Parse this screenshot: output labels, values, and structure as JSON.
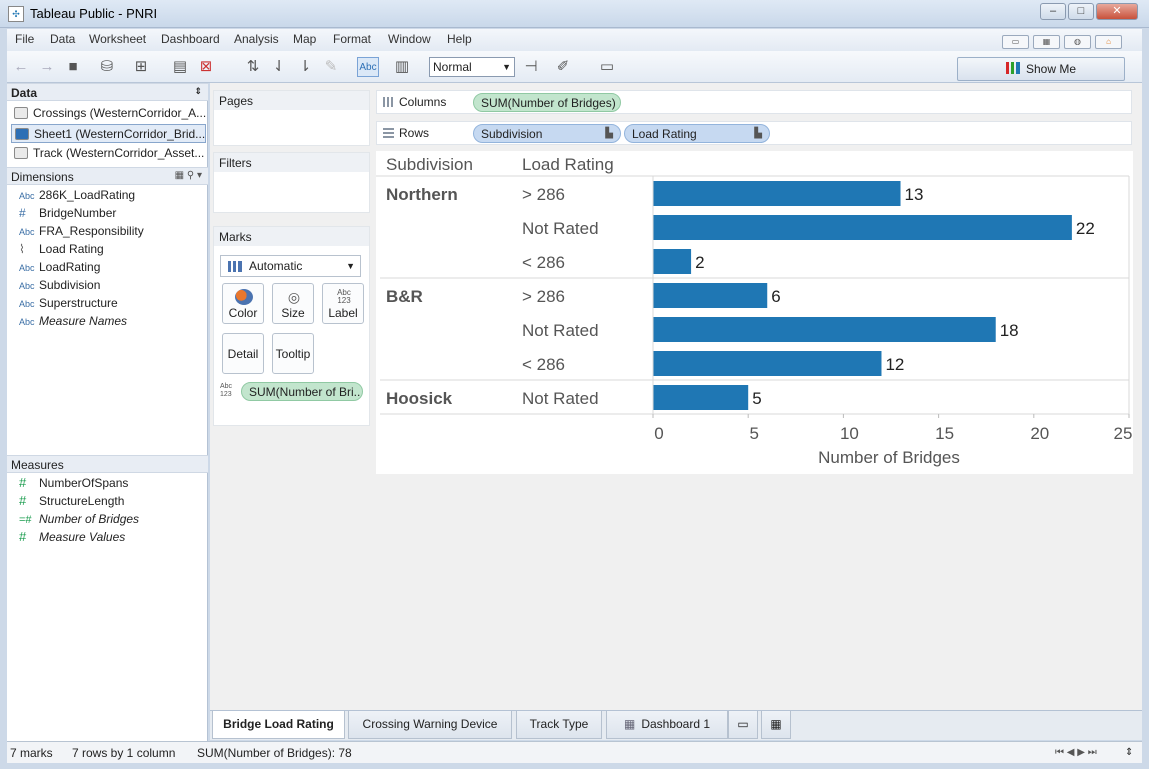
{
  "window": {
    "title": "Tableau Public - PNRI"
  },
  "menu": [
    "File",
    "Data",
    "Worksheet",
    "Dashboard",
    "Analysis",
    "Map",
    "Format",
    "Window",
    "Help"
  ],
  "toolbar": {
    "zoom": "Normal",
    "abc": "Abc",
    "show_me": "Show Me"
  },
  "data_pane": {
    "header": "Data",
    "sources": [
      "Crossings (WesternCorridor_A...",
      "Sheet1 (WesternCorridor_Brid...",
      "Track (WesternCorridor_Asset..."
    ],
    "dimensions_header": "Dimensions",
    "dimensions": [
      {
        "type": "Abc",
        "name": "286K_LoadRating"
      },
      {
        "type": "#",
        "name": "BridgeNumber"
      },
      {
        "type": "Abc",
        "name": "FRA_Responsibility"
      },
      {
        "type": "clip",
        "name": "Load Rating"
      },
      {
        "type": "Abc",
        "name": "LoadRating"
      },
      {
        "type": "Abc",
        "name": "Subdivision"
      },
      {
        "type": "Abc",
        "name": "Superstructure"
      },
      {
        "type": "Abc",
        "name": "Measure Names"
      }
    ],
    "measures_header": "Measures",
    "measures": [
      {
        "type": "#",
        "name": "NumberOfSpans"
      },
      {
        "type": "#",
        "name": "StructureLength"
      },
      {
        "type": "=#",
        "name": "Number of Bridges"
      },
      {
        "type": "#",
        "name": "Measure Values"
      }
    ]
  },
  "cards": {
    "pages": "Pages",
    "filters": "Filters",
    "marks": "Marks",
    "marks_type": "Automatic",
    "buttons": {
      "color": "Color",
      "size": "Size",
      "label": "Label",
      "detail": "Detail",
      "tooltip": "Tooltip"
    },
    "label_pill": "SUM(Number of Bri..",
    "abc123": "Abc 123"
  },
  "shelves": {
    "columns_label": "Columns",
    "columns_pill": "SUM(Number of Bridges)",
    "rows_label": "Rows",
    "rows_pills": [
      "Subdivision",
      "Load Rating"
    ]
  },
  "chart_data": {
    "type": "bar",
    "orientation": "horizontal",
    "row_headers": [
      "Subdivision",
      "Load Rating"
    ],
    "groups": [
      {
        "subdivision": "Northern",
        "rows": [
          {
            "load_rating": "> 286",
            "value": 13
          },
          {
            "load_rating": "Not Rated",
            "value": 22
          },
          {
            "load_rating": "< 286",
            "value": 2
          }
        ]
      },
      {
        "subdivision": "B&R",
        "rows": [
          {
            "load_rating": "> 286",
            "value": 6
          },
          {
            "load_rating": "Not Rated",
            "value": 18
          },
          {
            "load_rating": "< 286",
            "value": 12
          }
        ]
      },
      {
        "subdivision": "Hoosick",
        "rows": [
          {
            "load_rating": "Not Rated",
            "value": 5
          }
        ]
      }
    ],
    "xlabel": "Number of Bridges",
    "xlim": [
      0,
      25
    ],
    "xticks": [
      0,
      5,
      10,
      15,
      20,
      25
    ],
    "bar_color": "#1f77b4"
  },
  "tabs": [
    "Bridge Load Rating",
    "Crossing Warning Device",
    "Track Type",
    "Dashboard 1"
  ],
  "status": {
    "marks": "7 marks",
    "rows": "7 rows by 1 column",
    "sum": "SUM(Number of Bridges): 78"
  }
}
